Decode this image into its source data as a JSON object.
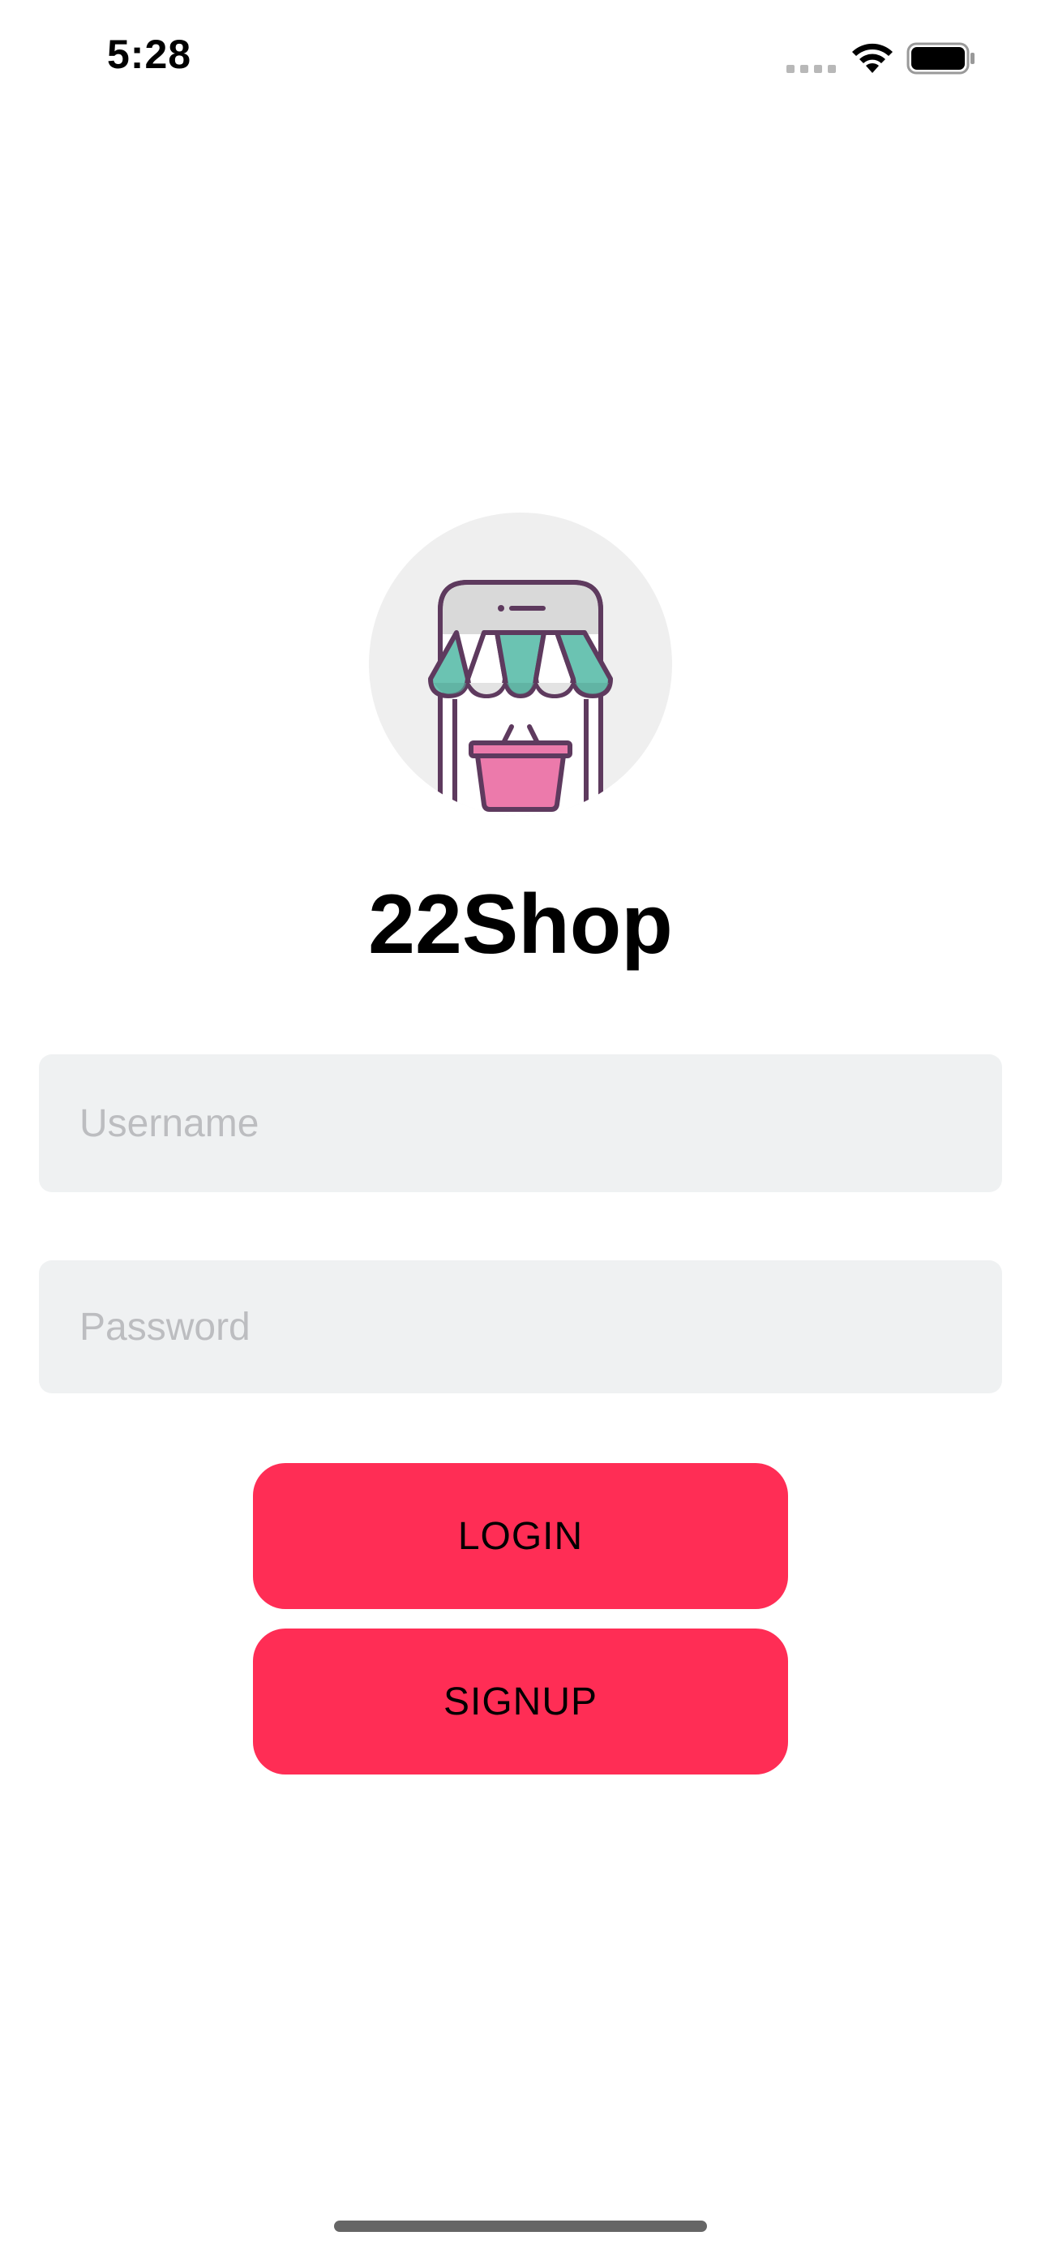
{
  "status_bar": {
    "time": "5:28"
  },
  "app": {
    "title": "22Shop",
    "logo_icon": "storefront-basket-icon"
  },
  "form": {
    "username_placeholder": "Username",
    "password_placeholder": "Password",
    "username_value": "",
    "password_value": ""
  },
  "buttons": {
    "login_label": "LOGIN",
    "signup_label": "SIGNUP"
  },
  "colors": {
    "accent": "#ff2d55",
    "field_background": "#eff1f2",
    "placeholder": "#bcbdc0",
    "logo_background": "#efefef",
    "awning_teal": "#6bc3b2",
    "basket_pink": "#ec7aab",
    "outline_purple": "#5e3a5e"
  }
}
